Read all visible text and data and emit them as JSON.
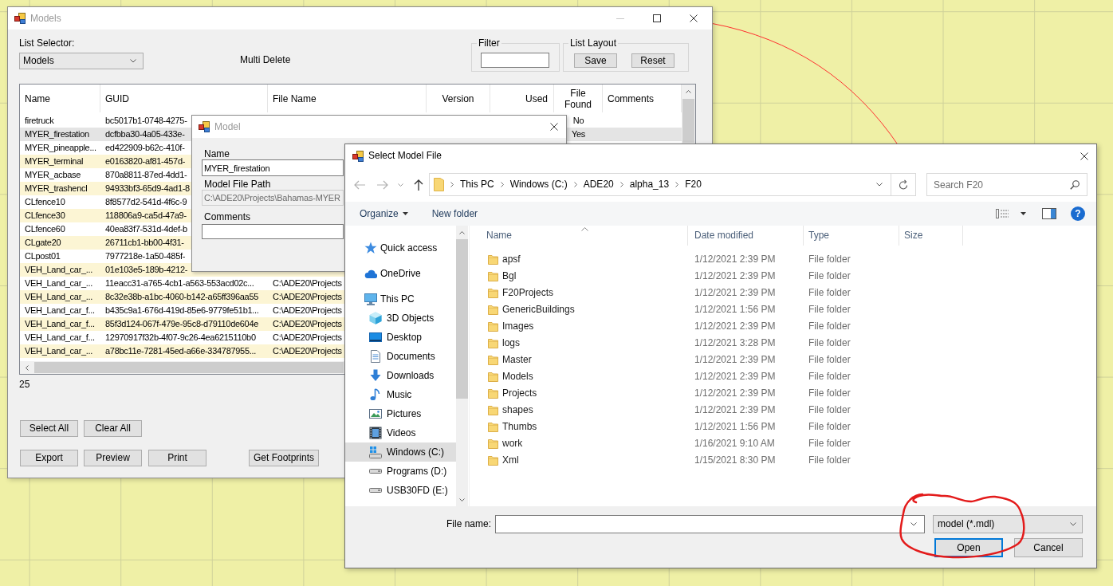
{
  "models_window": {
    "title": "Models",
    "active": false,
    "list_selector": {
      "label": "List Selector:",
      "value": "Models"
    },
    "multi_delete": "Multi Delete",
    "filter": {
      "label": "Filter"
    },
    "list_layout": {
      "label": "List Layout",
      "buttons": [
        "Save",
        "Reset"
      ]
    },
    "list": {
      "columns": [
        "Name",
        "GUID",
        "File Name",
        "Version",
        "Used",
        "File Found",
        "Comments"
      ],
      "rows": [
        {
          "name": "firetruck",
          "guid": "bc5017b1-0748-4275-",
          "file_found": "No",
          "selected": false
        },
        {
          "name": "MYER_firestation",
          "guid": "dcfbba30-4a05-433e-",
          "file_found": "Yes",
          "selected": true
        },
        {
          "name": "MYER_pineapple...",
          "guid": "ed422909-b62c-410f-",
          "selected": false
        },
        {
          "name": "MYER_terminal",
          "guid": "e0163820-af81-457d-",
          "selected": false
        },
        {
          "name": "MYER_acbase",
          "guid": "870a8811-87ed-4dd1-",
          "selected": false
        },
        {
          "name": "MYER_trashencl",
          "guid": "94933bf3-65d9-4ad1-8",
          "selected": false
        },
        {
          "name": "CLfence10",
          "guid": "8f8577d2-541d-4f6c-9",
          "selected": false
        },
        {
          "name": "CLfence30",
          "guid": "118806a9-ca5d-47a9-",
          "selected": false
        },
        {
          "name": "CLfence60",
          "guid": "40ea83f7-531d-4def-b",
          "selected": false
        },
        {
          "name": "CLgate20",
          "guid": "26711cb1-bb00-4f31-",
          "selected": false
        },
        {
          "name": "CLpost01",
          "guid": "7977218e-1a50-485f-",
          "selected": false
        },
        {
          "name": "VEH_Land_car_...",
          "guid": "01e103e5-189b-4212-",
          "selected": false
        },
        {
          "name": "VEH_Land_car_...",
          "guid": "11eacc31-a765-4cb1-a563-553acd02c...",
          "file_name": "C:\\ADE20\\Projects",
          "selected": false
        },
        {
          "name": "VEH_Land_car_...",
          "guid": "8c32e38b-a1bc-4060-b142-a65ff396aa55",
          "file_name": "C:\\ADE20\\Projects",
          "selected": false
        },
        {
          "name": "VEH_Land_car_f...",
          "guid": "b435c9a1-676d-419d-85e6-9779fe51b1...",
          "file_name": "C:\\ADE20\\Projects",
          "selected": false
        },
        {
          "name": "VEH_Land_car_f...",
          "guid": "85f3d124-067f-479e-95c8-d79110de604e",
          "file_name": "C:\\ADE20\\Projects",
          "selected": false
        },
        {
          "name": "VEH_Land_car_f...",
          "guid": "12970917f32b-4f07-9c26-4ea6215110b0",
          "file_name": "C:\\ADE20\\Projects",
          "selected": false
        },
        {
          "name": "VEH_Land_car_...",
          "guid": "a78bc11e-7281-45ed-a66e-334787955...",
          "file_name": "C:\\ADE20\\Projects",
          "selected": false
        }
      ]
    },
    "count": "25",
    "button_rows": [
      [
        "Select All",
        "Clear All"
      ],
      [
        "Export",
        "Preview",
        "Print",
        "Get Footprints"
      ]
    ]
  },
  "model_dialog": {
    "title": "Model",
    "active": false,
    "fields": [
      {
        "label": "Name",
        "value": "MYER_firestation",
        "disabled": false
      },
      {
        "label": "Model File Path",
        "value": "C:\\ADE20\\Projects\\Bahamas-MYER",
        "disabled": true
      },
      {
        "label": "Comments",
        "disabled": false
      }
    ]
  },
  "file_dialog": {
    "title": "Select Model File",
    "active": true,
    "breadcrumb": [
      "This PC",
      "Windows (C:)",
      "ADE20",
      "alpha_13",
      "F20"
    ],
    "search": {
      "placeholder": "Search F20"
    },
    "toolbar": [
      {
        "label": "Organize",
        "menu": true
      },
      {
        "label": "New folder",
        "menu": false
      }
    ],
    "help_button": "?",
    "nav": [
      {
        "label": "Quick access",
        "kind": "star",
        "selected": false
      },
      {
        "label": "OneDrive",
        "kind": "cloud",
        "selected": false
      },
      {
        "label": "This PC",
        "kind": "computer",
        "selected": false,
        "children": [
          {
            "label": "3D Objects",
            "kind": "cube",
            "selected": false
          },
          {
            "label": "Desktop",
            "kind": "desktop",
            "selected": false
          },
          {
            "label": "Documents",
            "kind": "documents",
            "selected": false
          },
          {
            "label": "Downloads",
            "kind": "downloads",
            "selected": false
          },
          {
            "label": "Music",
            "kind": "music",
            "selected": false
          },
          {
            "label": "Pictures",
            "kind": "pictures",
            "selected": false
          },
          {
            "label": "Videos",
            "kind": "videos",
            "selected": false
          },
          {
            "label": "Windows (C:)",
            "kind": "sysdrive",
            "selected": true
          },
          {
            "label": "Programs (D:)",
            "kind": "drive",
            "selected": false
          },
          {
            "label": "USB30FD (E:)",
            "kind": "drive",
            "selected": false
          }
        ]
      }
    ],
    "columns": [
      {
        "label": "Name",
        "sorted": true
      },
      {
        "label": "Date modified",
        "sorted": false
      },
      {
        "label": "Type",
        "sorted": false
      },
      {
        "label": "Size",
        "sorted": false
      }
    ],
    "files": [
      {
        "name": "apsf",
        "date_modified": "1/12/2021 2:39 PM",
        "type": "File folder"
      },
      {
        "name": "Bgl",
        "date_modified": "1/12/2021 2:39 PM",
        "type": "File folder"
      },
      {
        "name": "F20Projects",
        "date_modified": "1/12/2021 2:39 PM",
        "type": "File folder"
      },
      {
        "name": "GenericBuildings",
        "date_modified": "1/12/2021 1:56 PM",
        "type": "File folder"
      },
      {
        "name": "Images",
        "date_modified": "1/12/2021 2:39 PM",
        "type": "File folder"
      },
      {
        "name": "logs",
        "date_modified": "1/12/2021 3:28 PM",
        "type": "File folder"
      },
      {
        "name": "Master",
        "date_modified": "1/12/2021 2:39 PM",
        "type": "File folder"
      },
      {
        "name": "Models",
        "date_modified": "1/12/2021 2:39 PM",
        "type": "File folder"
      },
      {
        "name": "Projects",
        "date_modified": "1/12/2021 2:39 PM",
        "type": "File folder"
      },
      {
        "name": "shapes",
        "date_modified": "1/12/2021 2:39 PM",
        "type": "File folder"
      },
      {
        "name": "Thumbs",
        "date_modified": "1/12/2021 1:56 PM",
        "type": "File folder"
      },
      {
        "name": "work",
        "date_modified": "1/16/2021 9:10 AM",
        "type": "File folder"
      },
      {
        "name": "Xml",
        "date_modified": "1/15/2021 8:30 PM",
        "type": "File folder"
      }
    ],
    "file_name": {
      "label": "File name:"
    },
    "file_type": {
      "value": "model (*.mdl)"
    },
    "buttons": [
      {
        "label": "Open",
        "default": true
      },
      {
        "label": "Cancel",
        "default": false
      }
    ]
  }
}
